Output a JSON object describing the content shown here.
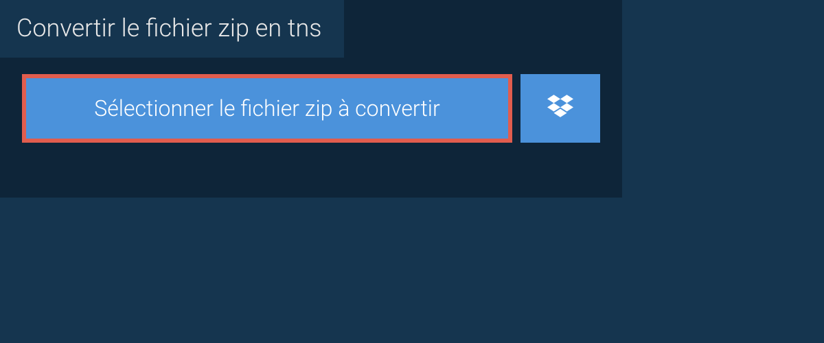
{
  "header": {
    "title": "Convertir le fichier zip en tns"
  },
  "actions": {
    "select_file_label": "Sélectionner le fichier zip à convertir"
  }
}
